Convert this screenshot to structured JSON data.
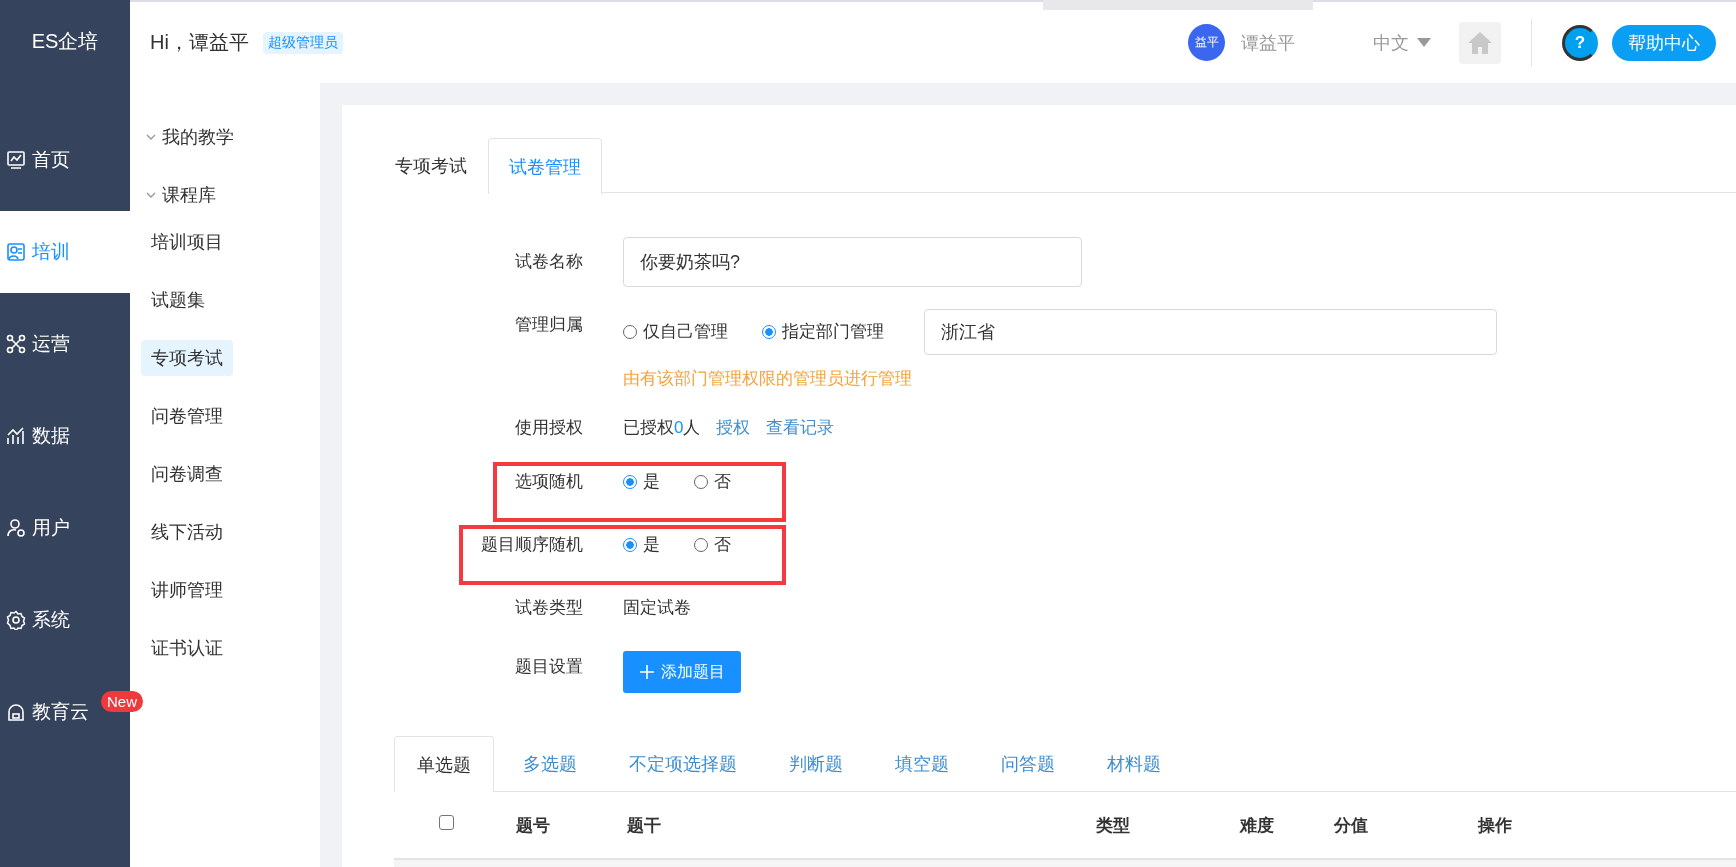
{
  "brand": {
    "logo": "ES企培"
  },
  "header": {
    "greeting": "Hi，谭益平",
    "role_tag": "超级管理员",
    "avatar_text": "益平",
    "user_name": "谭益平",
    "language": "中文",
    "help_symbol": "?",
    "help_label": "帮助中心"
  },
  "nav_rail": [
    {
      "label": "首页",
      "selected": false
    },
    {
      "label": "培训",
      "selected": true
    },
    {
      "label": "运营",
      "selected": false
    },
    {
      "label": "数据",
      "selected": false
    },
    {
      "label": "用户",
      "selected": false
    },
    {
      "label": "系统",
      "selected": false
    },
    {
      "label": "教育云",
      "selected": false,
      "badge": "New"
    }
  ],
  "sub_menu": [
    {
      "label": "我的教学",
      "expanded": true
    },
    {
      "label": "课程库",
      "expanded": true,
      "children": [
        {
          "label": "培训项目",
          "selected": false
        },
        {
          "label": "试题集",
          "selected": false
        },
        {
          "label": "专项考试",
          "selected": true
        },
        {
          "label": "问卷管理",
          "selected": false
        },
        {
          "label": "问卷调查",
          "selected": false
        },
        {
          "label": "线下活动",
          "selected": false
        },
        {
          "label": "讲师管理",
          "selected": false
        },
        {
          "label": "证书认证",
          "selected": false
        }
      ]
    }
  ],
  "page_tabs": [
    {
      "label": "专项考试",
      "selected": false
    },
    {
      "label": "试卷管理",
      "selected": true
    }
  ],
  "form": {
    "rows": [
      {
        "kind": "input",
        "label": "试卷名称",
        "value": "你要奶茶吗?"
      },
      {
        "kind": "radio",
        "label": "管理归属",
        "options": [
          {
            "label": "仅自己管理",
            "selected": false
          },
          {
            "label": "指定部门管理",
            "selected": true
          }
        ],
        "field_value": "浙江省",
        "hint": "由有该部门管理权限的管理员进行管理"
      },
      {
        "kind": "grant",
        "label": "使用授权",
        "prefix": "已授权",
        "count": "0",
        "suffix": "人",
        "links": [
          "授权",
          "查看记录"
        ]
      },
      {
        "kind": "radio",
        "label": "选项随机",
        "highlighted": true,
        "options": [
          {
            "label": "是",
            "selected": true
          },
          {
            "label": "否",
            "selected": false
          }
        ]
      },
      {
        "kind": "radio",
        "label": "题目顺序随机",
        "highlighted": true,
        "options": [
          {
            "label": "是",
            "selected": true
          },
          {
            "label": "否",
            "selected": false
          }
        ]
      },
      {
        "kind": "text",
        "label": "试卷类型",
        "value": "固定试卷"
      },
      {
        "kind": "button",
        "label": "题目设置",
        "button": "添加题目"
      }
    ]
  },
  "question_tabs": [
    {
      "label": "单选题",
      "selected": true
    },
    {
      "label": "多选题",
      "selected": false
    },
    {
      "label": "不定项选择题",
      "selected": false
    },
    {
      "label": "判断题",
      "selected": false
    },
    {
      "label": "填空题",
      "selected": false
    },
    {
      "label": "问答题",
      "selected": false
    },
    {
      "label": "材料题",
      "selected": false
    }
  ],
  "table": {
    "select_all": {
      "checked": false
    },
    "columns": [
      "题号",
      "题干",
      "类型",
      "难度",
      "分值",
      "操作"
    ]
  }
}
